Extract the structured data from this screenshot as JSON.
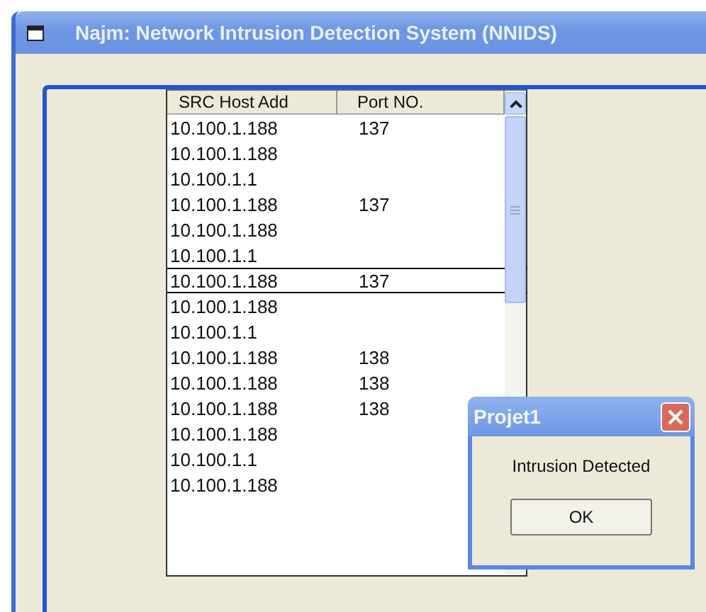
{
  "window": {
    "title": "Najm:  Network Intrusion Detection System (NNIDS)"
  },
  "table": {
    "columns": [
      "SRC Host Add",
      "Port NO."
    ],
    "rows": [
      {
        "host": "10.100.1.188",
        "port": "137",
        "selected": false
      },
      {
        "host": "10.100.1.188",
        "port": "",
        "selected": false
      },
      {
        "host": "10.100.1.1",
        "port": "",
        "selected": false
      },
      {
        "host": "10.100.1.188",
        "port": "137",
        "selected": false
      },
      {
        "host": "10.100.1.188",
        "port": "",
        "selected": false
      },
      {
        "host": "10.100.1.1",
        "port": "",
        "selected": false
      },
      {
        "host": "10.100.1.188",
        "port": "137",
        "selected": true
      },
      {
        "host": "10.100.1.188",
        "port": "",
        "selected": false
      },
      {
        "host": "10.100.1.1",
        "port": "",
        "selected": false
      },
      {
        "host": "10.100.1.188",
        "port": "138",
        "selected": false
      },
      {
        "host": "10.100.1.188",
        "port": "138",
        "selected": false
      },
      {
        "host": "10.100.1.188",
        "port": "138",
        "selected": false
      },
      {
        "host": "10.100.1.188",
        "port": "",
        "selected": false
      },
      {
        "host": "10.100.1.1",
        "port": "",
        "selected": false
      },
      {
        "host": "10.100.1.188",
        "port": "",
        "selected": false
      }
    ]
  },
  "dialog": {
    "title": "Projet1",
    "message": "Intrusion Detected",
    "button": "OK"
  }
}
